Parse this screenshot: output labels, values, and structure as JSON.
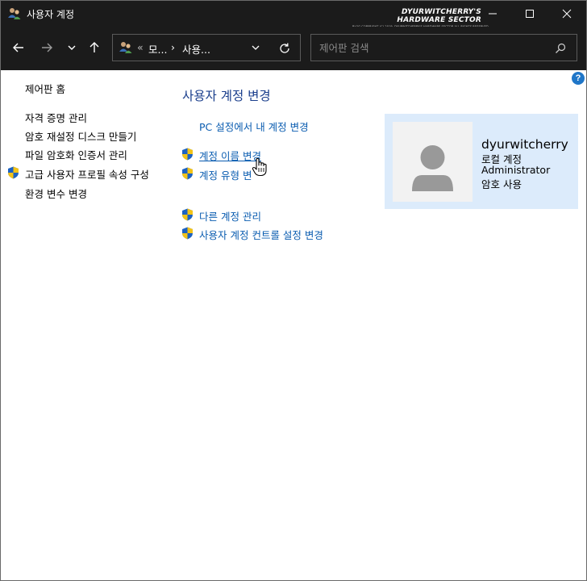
{
  "window": {
    "title": "사용자 계정",
    "watermark_main": "DYURWITCHERRY'S HARDWARE SECTOR",
    "watermark_sub": "BLOG COPYRIGHT (C) 2019. DYURWITCHERRY'S HARDWARE SECTOR ALL RIGHTS RESERVED."
  },
  "address": {
    "chevron": "«",
    "segment1": "모...",
    "separator": "›",
    "segment2": "사용..."
  },
  "search": {
    "placeholder": "제어판 검색"
  },
  "help": {
    "label": "?"
  },
  "left_pane": {
    "home": "제어판 홈",
    "items": [
      {
        "label": "자격 증명 관리",
        "shield": false
      },
      {
        "label": "암호 재설정 디스크 만들기",
        "shield": false
      },
      {
        "label": "파일 암호화 인증서 관리",
        "shield": false
      },
      {
        "label": "고급 사용자 프로필 속성 구성",
        "shield": true
      },
      {
        "label": "환경 변수 변경",
        "shield": false
      }
    ]
  },
  "main": {
    "title": "사용자 계정 변경",
    "pc_settings_link": "PC 설정에서 내 계정 변경",
    "rename_link": "계정 이름 변경",
    "type_link": "계정 유형 변",
    "other_link": "다른 계정 관리",
    "uac_link": "사용자 계정 컨트롤 설정 변경"
  },
  "account": {
    "name": "dyurwitcherry",
    "type": "로컬 계정",
    "role": "Administrator",
    "password": "암호 사용"
  },
  "colors": {
    "titlebar": "#1b1b1b",
    "link": "#0a5cb0",
    "heading": "#1a3e8c",
    "card_bg": "#dcebfb",
    "help": "#1f76c8"
  }
}
